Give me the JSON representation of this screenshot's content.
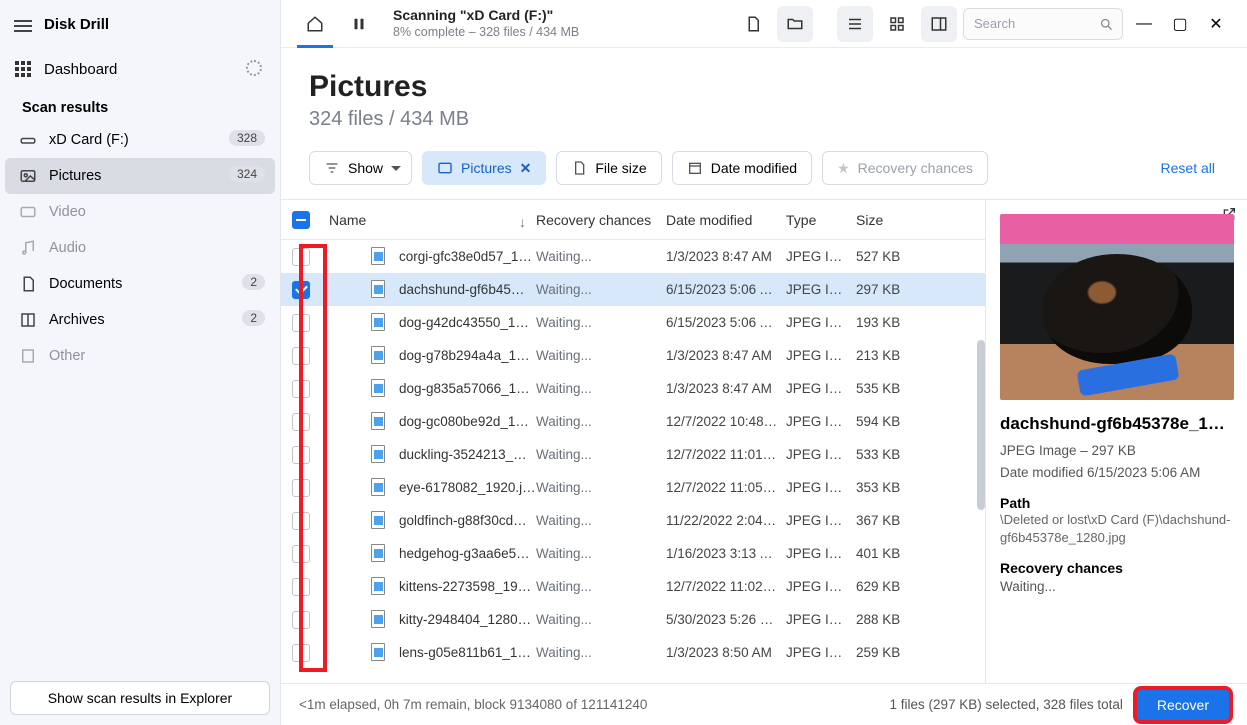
{
  "app_name": "Disk Drill",
  "sidebar": {
    "dashboard": "Dashboard",
    "scan_results": "Scan results",
    "items": [
      {
        "label": "xD Card (F:)",
        "badge": "328"
      },
      {
        "label": "Pictures",
        "badge": "324"
      },
      {
        "label": "Video"
      },
      {
        "label": "Audio"
      },
      {
        "label": "Documents",
        "badge": "2"
      },
      {
        "label": "Archives",
        "badge": "2"
      },
      {
        "label": "Other"
      }
    ],
    "explorer_btn": "Show scan results in Explorer"
  },
  "toolbar": {
    "title": "Scanning \"xD Card (F:)\"",
    "subtitle": "8% complete – 328 files / 434 MB",
    "search_placeholder": "Search"
  },
  "header": {
    "title": "Pictures",
    "subtitle": "324 files / 434 MB"
  },
  "filters": {
    "show": "Show",
    "pictures": "Pictures",
    "filesize": "File size",
    "date": "Date modified",
    "recovery": "Recovery chances",
    "reset": "Reset all"
  },
  "columns": {
    "name": "Name",
    "rec": "Recovery chances",
    "date": "Date modified",
    "type": "Type",
    "size": "Size"
  },
  "rows": [
    {
      "name": "corgi-gfc38e0d57_1…",
      "rec": "Waiting...",
      "date": "1/3/2023 8:47 AM",
      "type": "JPEG Im…",
      "size": "527 KB",
      "sel": false
    },
    {
      "name": "dachshund-gf6b45…",
      "rec": "Waiting...",
      "date": "6/15/2023 5:06 A…",
      "type": "JPEG Im…",
      "size": "297 KB",
      "sel": true
    },
    {
      "name": "dog-g42dc43550_1…",
      "rec": "Waiting...",
      "date": "6/15/2023 5:06 A…",
      "type": "JPEG Im…",
      "size": "193 KB",
      "sel": false
    },
    {
      "name": "dog-g78b294a4a_1…",
      "rec": "Waiting...",
      "date": "1/3/2023 8:47 AM",
      "type": "JPEG Im…",
      "size": "213 KB",
      "sel": false
    },
    {
      "name": "dog-g835a57066_1…",
      "rec": "Waiting...",
      "date": "1/3/2023 8:47 AM",
      "type": "JPEG Im…",
      "size": "535 KB",
      "sel": false
    },
    {
      "name": "dog-gc080be92d_1…",
      "rec": "Waiting...",
      "date": "12/7/2022 10:48…",
      "type": "JPEG Im…",
      "size": "594 KB",
      "sel": false
    },
    {
      "name": "duckling-3524213_…",
      "rec": "Waiting...",
      "date": "12/7/2022 11:01…",
      "type": "JPEG Im…",
      "size": "533 KB",
      "sel": false
    },
    {
      "name": "eye-6178082_1920.j…",
      "rec": "Waiting...",
      "date": "12/7/2022 11:05…",
      "type": "JPEG Im…",
      "size": "353 KB",
      "sel": false
    },
    {
      "name": "goldfinch-g88f30cd…",
      "rec": "Waiting...",
      "date": "11/22/2022 2:04…",
      "type": "JPEG Im…",
      "size": "367 KB",
      "sel": false
    },
    {
      "name": "hedgehog-g3aa6e5…",
      "rec": "Waiting...",
      "date": "1/16/2023 3:13 A…",
      "type": "JPEG Im…",
      "size": "401 KB",
      "sel": false
    },
    {
      "name": "kittens-2273598_19…",
      "rec": "Waiting...",
      "date": "12/7/2022 11:02…",
      "type": "JPEG Im…",
      "size": "629 KB",
      "sel": false
    },
    {
      "name": "kitty-2948404_1280…",
      "rec": "Waiting...",
      "date": "5/30/2023 5:26 PM",
      "type": "JPEG Im…",
      "size": "288 KB",
      "sel": false
    },
    {
      "name": "lens-g05e811b61_1…",
      "rec": "Waiting...",
      "date": "1/3/2023 8:50 AM",
      "type": "JPEG Im…",
      "size": "259 KB",
      "sel": false
    }
  ],
  "preview": {
    "title": "dachshund-gf6b45378e_12…",
    "meta1": "JPEG Image – 297 KB",
    "meta2": "Date modified 6/15/2023 5:06 AM",
    "path_label": "Path",
    "path": "\\Deleted or lost\\xD Card (F)\\dachshund-gf6b45378e_1280.jpg",
    "rec_label": "Recovery chances",
    "rec": "Waiting..."
  },
  "footer": {
    "status": "<1m elapsed, 0h 7m remain, block 9134080 of 121141240",
    "selection": "1 files (297 KB) selected, 328 files total",
    "recover": "Recover"
  }
}
